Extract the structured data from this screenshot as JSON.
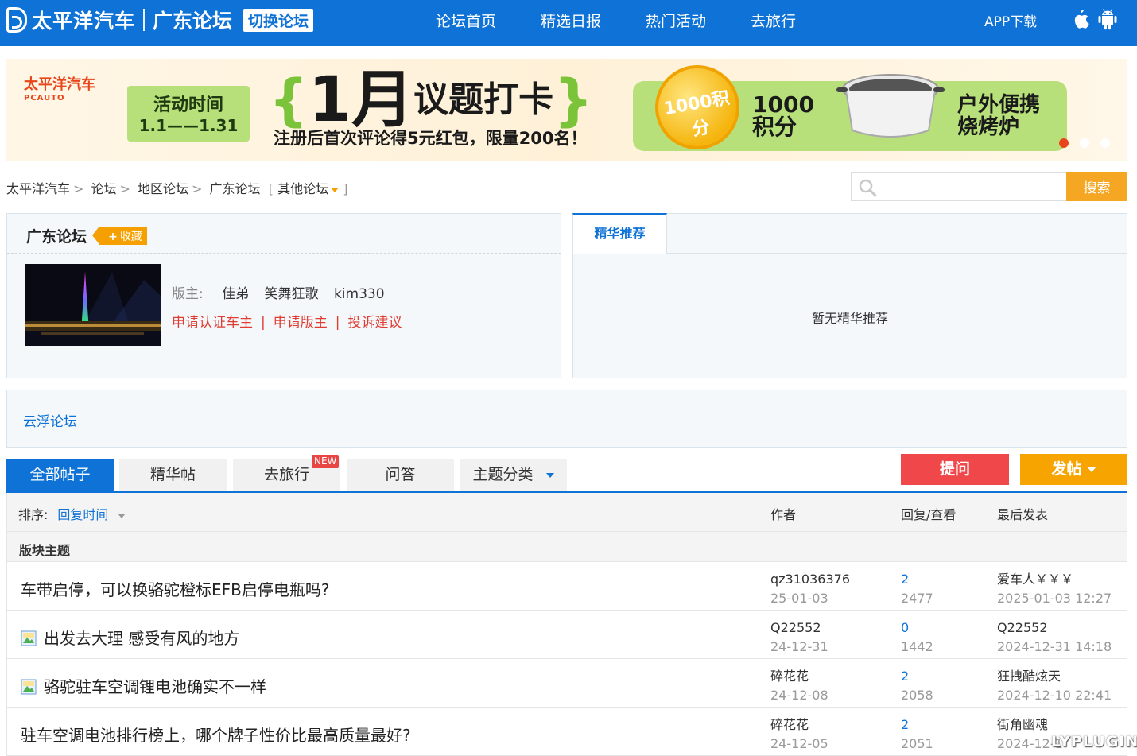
{
  "header": {
    "logo_text": "太平洋汽车",
    "forum_name": "广东论坛",
    "switch_label": "切换论坛",
    "nav": [
      "论坛首页",
      "精选日报",
      "热门活动",
      "去旅行"
    ],
    "app_download": "APP下载",
    "icons": [
      "apple-icon",
      "android-icon"
    ]
  },
  "banner": {
    "brand": "太平洋汽车",
    "brand_en": "PCAUTO",
    "time_label": "活动时间",
    "time_range": "1.1——1.31",
    "title_big": "1月",
    "title_rest": "议题打卡",
    "subtitle": "注册后首次评论得5元红包，限量200名！",
    "coin_text": "1000积分",
    "points_l1": "1000",
    "points_l2": "积分",
    "prize_l1": "户外便携",
    "prize_l2": "烧烤炉"
  },
  "breadcrumb": {
    "items": [
      "太平洋汽车",
      "论坛",
      "地区论坛",
      "广东论坛"
    ],
    "other": "其他论坛"
  },
  "search": {
    "placeholder": "",
    "button": "搜索"
  },
  "forum_info": {
    "title": "广东论坛",
    "fav_label": "收藏",
    "moderator_label": "版主:",
    "moderators": [
      "佳弟",
      "笑舞狂歌",
      "kim330"
    ],
    "links": [
      "申请认证车主",
      "申请版主",
      "投诉建议"
    ]
  },
  "recommend": {
    "tab": "精华推荐",
    "empty": "暂无精华推荐"
  },
  "subforum": {
    "label": "云浮论坛"
  },
  "tabs": {
    "items": [
      "全部帖子",
      "精华帖",
      "去旅行",
      "问答",
      "主题分类"
    ],
    "new_badge": "NEW",
    "ask_button": "提问",
    "post_button": "发帖"
  },
  "list": {
    "sort_label": "排序:",
    "sort_value": "回复时间",
    "col_author": "作者",
    "col_reply": "回复/查看",
    "col_last": "最后发表",
    "section": "版块主题",
    "rows": [
      {
        "title": "车带启停，可以换骆驼橙标EFB启停电瓶吗?",
        "has_image": false,
        "author": "qz31036376",
        "date": "25-01-03",
        "replies": "2",
        "views": "2477",
        "last_user": "爱车人￥￥￥",
        "last_time": "2025-01-03 12:27"
      },
      {
        "title": "出发去大理 感受有风的地方",
        "has_image": true,
        "author": "Q22552",
        "date": "24-12-31",
        "replies": "0",
        "views": "1442",
        "last_user": "Q22552",
        "last_time": "2024-12-31 14:18"
      },
      {
        "title": "骆驼驻车空调锂电池确实不一样",
        "has_image": true,
        "author": "碎花花",
        "date": "24-12-08",
        "replies": "2",
        "views": "2058",
        "last_user": "狂拽酷炫天",
        "last_time": "2024-12-10 22:41"
      },
      {
        "title": "驻车空调电池排行榜上，哪个牌子性价比最高质量最好?",
        "has_image": false,
        "author": "碎花花",
        "date": "24-12-05",
        "replies": "2",
        "views": "2051",
        "last_user": "街角幽魂",
        "last_time": "2024-12-1"
      }
    ]
  },
  "watermark": "LYPLUGIN",
  "colors": {
    "primary": "#0f72d6",
    "orange": "#f5a623",
    "red": "#f0474a",
    "link_red": "#e03c31"
  }
}
